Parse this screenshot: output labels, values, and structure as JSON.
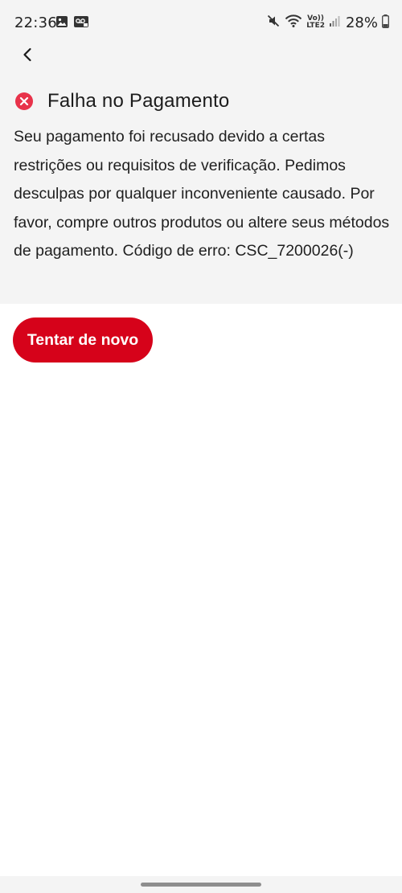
{
  "status_bar": {
    "time": "22:36",
    "battery_percent": "28%",
    "network_label_top": "Vo))",
    "network_label_bottom": "LTE2"
  },
  "header": {
    "back_icon": "chevron-left-icon"
  },
  "error": {
    "icon": "error-circle-x-icon",
    "icon_color": "#e8324a",
    "title": "Falha no Pagamento",
    "message": "Seu pagamento foi recusado devido a certas restrições ou requisitos de verificação. Pedimos desculpas por qualquer inconveniente causado. Por favor, compre outros produtos ou altere seus métodos de pagamento. Código de erro: CSC_7200026(-)"
  },
  "actions": {
    "retry_label": "Tentar de novo",
    "retry_color": "#d6021a"
  },
  "colors": {
    "header_background": "#f4f4f4",
    "page_background": "#ffffff"
  }
}
